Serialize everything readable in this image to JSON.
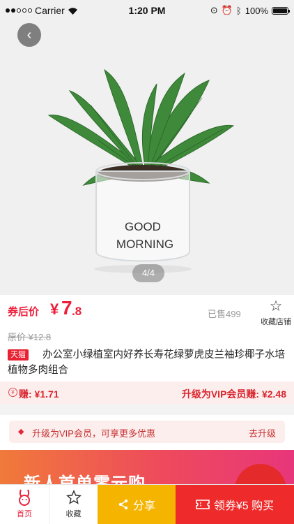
{
  "status_bar": {
    "carrier": "Carrier",
    "time": "1:20 PM",
    "battery": "100%"
  },
  "gallery": {
    "page_indicator": "4/4",
    "pot_text_line1": "GOOD",
    "pot_text_line2": "MORNING"
  },
  "price": {
    "coupon_label": "券后价",
    "currency": "¥",
    "integer": "7",
    "decimal": ".8",
    "sold": "已售499",
    "original_price": "原价 ¥12.8",
    "fav_shop_label": "收藏店铺"
  },
  "product": {
    "badge": "天猫",
    "title": "办公室小绿植室内好养长寿花绿萝虎皮兰袖珍椰子水培植物多肉组合"
  },
  "earn": {
    "icon_char": "¥",
    "left": "赚: ¥1.71",
    "right": "升级为VIP会员赚: ¥2.48"
  },
  "vip": {
    "text": "升级为VIP会员，可享更多优惠",
    "action": "去升级"
  },
  "banner": {
    "text": "新人首单零元购"
  },
  "bottom_bar": {
    "home_label": "首页",
    "fav_label": "收藏",
    "share_label": "分享",
    "buy_label": "领券¥5 购买"
  },
  "colors": {
    "accent_red": "#ee1e3a",
    "share_yellow": "#f4b400",
    "buy_red": "#ee2a2a"
  }
}
